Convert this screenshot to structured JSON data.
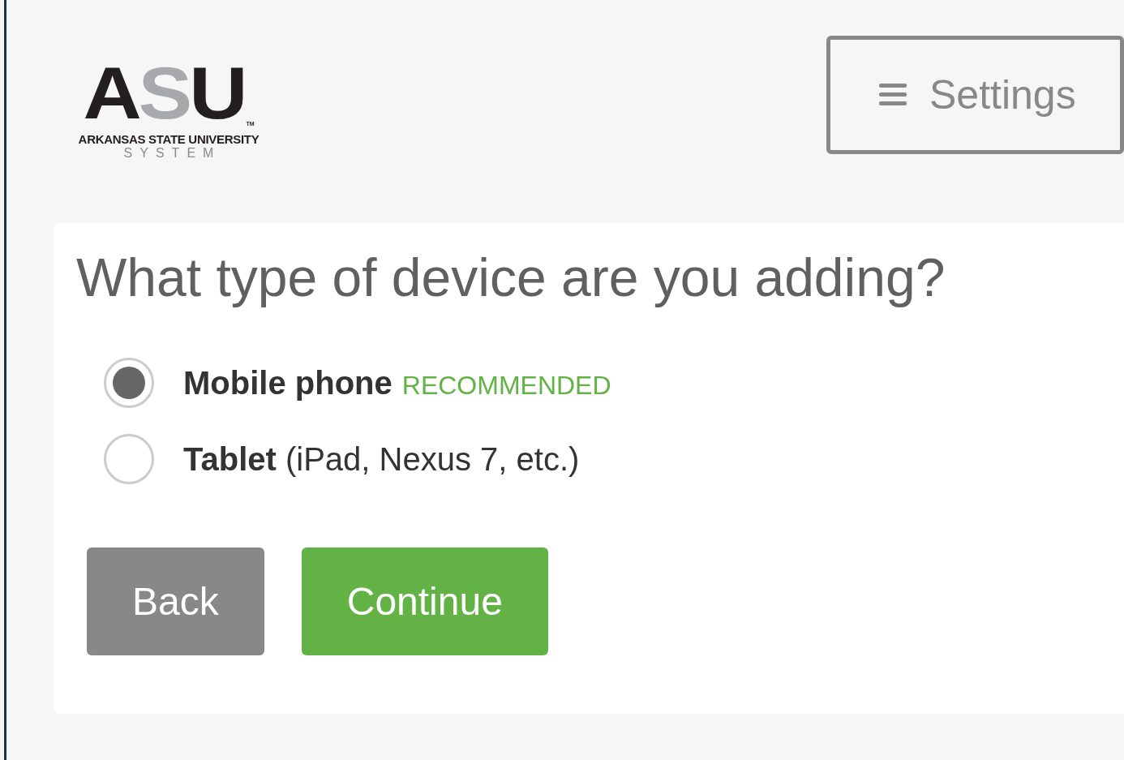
{
  "logo": {
    "mark": [
      {
        "letter": "A",
        "color": "#231f20"
      },
      {
        "letter": "S",
        "color": "#a7a9ac"
      },
      {
        "letter": "U",
        "color": "#231f20"
      }
    ],
    "trademark": "TM",
    "name": "ARKANSAS STATE UNIVERSITY",
    "subtitle": "SYSTEM"
  },
  "settings_button": {
    "label": "Settings"
  },
  "question": "What type of device are you adding?",
  "options": [
    {
      "name": "Mobile phone",
      "badge": "RECOMMENDED",
      "selected": true
    },
    {
      "name": "Tablet",
      "detail": "(iPad, Nexus 7, etc.)",
      "selected": false
    }
  ],
  "buttons": [
    {
      "label": "Back",
      "kind": "secondary"
    },
    {
      "label": "Continue",
      "kind": "primary"
    }
  ]
}
